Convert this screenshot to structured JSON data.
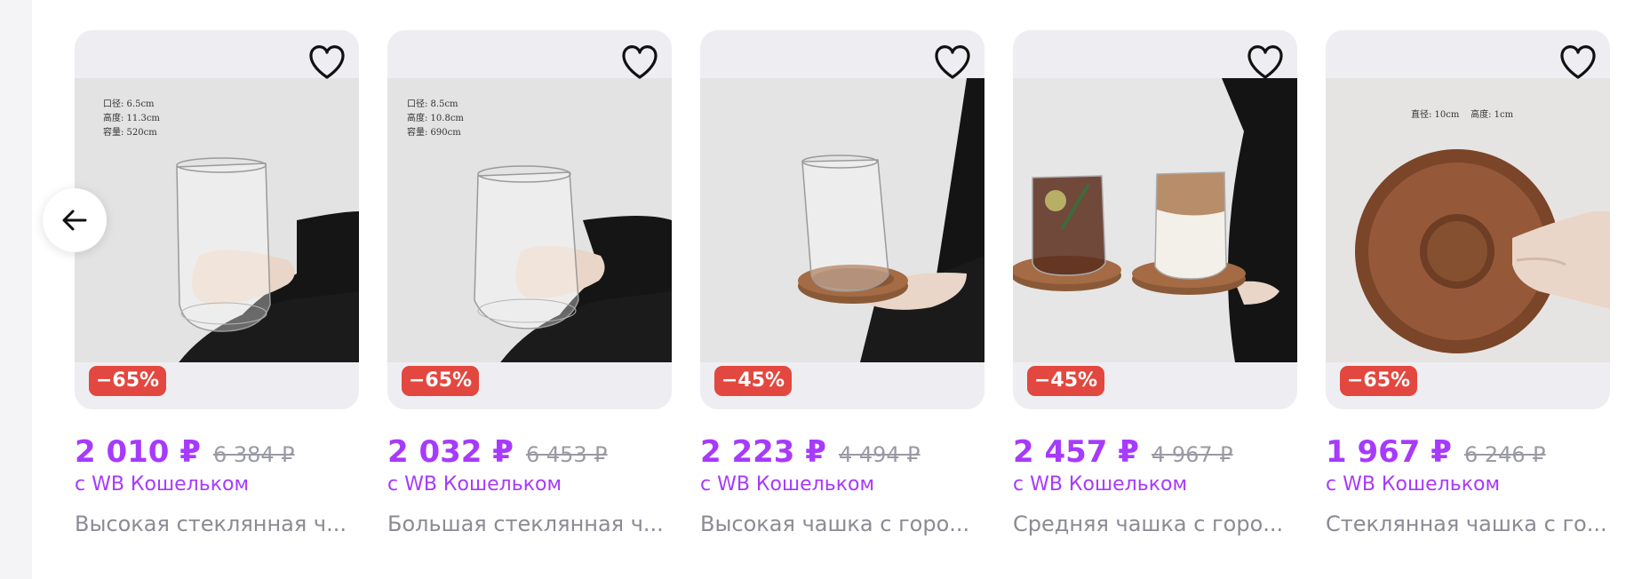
{
  "products": [
    {
      "discount": "−65%",
      "price": "2 010 ₽",
      "old_price": "6 384 ₽",
      "wallet": "с WB Кошельком",
      "title": "Высокая стеклянная ч...",
      "photo_text": "口径: 6.5cm\n高度: 11.3cm\n容量: 520cm"
    },
    {
      "discount": "−65%",
      "price": "2 032 ₽",
      "old_price": "6 453 ₽",
      "wallet": "с WB Кошельком",
      "title": "Большая стеклянная ч...",
      "photo_text": "口径: 8.5cm\n高度: 10.8cm\n容量: 690cm"
    },
    {
      "discount": "−45%",
      "price": "2 223 ₽",
      "old_price": "4 494 ₽",
      "wallet": "с WB Кошельком",
      "title": "Высокая чашка с горо...",
      "photo_text": ""
    },
    {
      "discount": "−45%",
      "price": "2 457 ₽",
      "old_price": "4 967 ₽",
      "wallet": "с WB Кошельком",
      "title": "Средняя чашка с горо...",
      "photo_text": ""
    },
    {
      "discount": "−65%",
      "price": "1 967 ₽",
      "old_price": "6 246 ₽",
      "wallet": "с WB Кошельком",
      "title": "Стеклянная чашка с го...",
      "photo_text": "直径: 10cm    高度: 1cm"
    }
  ],
  "icons": {
    "favorite": "heart-outline-icon",
    "nav_prev": "arrow-left-icon"
  },
  "colors": {
    "price": "#a73afd",
    "discount_badge": "#e2483f",
    "old_price": "#9a9aa4",
    "title": "#8b8b95",
    "card_bg": "#eeeef2"
  }
}
